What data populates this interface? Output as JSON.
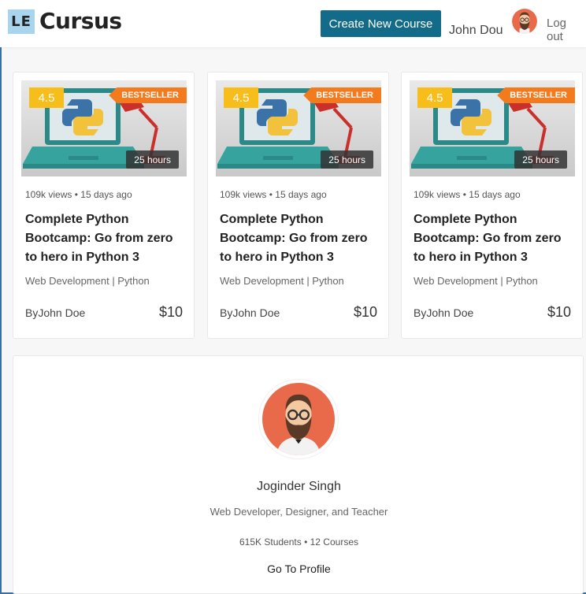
{
  "header": {
    "logo_mark": "LE",
    "brand": "Cursus",
    "create_button": "Create New Course",
    "user_name": "John Dou",
    "logout": "Log out"
  },
  "courses": [
    {
      "rating": "4.5",
      "badge": "BESTSELLER",
      "duration": "25 hours",
      "views": "109k views",
      "separator": "•",
      "age": "15 days ago",
      "title": "Complete Python Bootcamp: Go from zero to hero in Python 3",
      "category": "Web Development | Python",
      "by": "By",
      "author": "John Doe",
      "price": "$10"
    },
    {
      "rating": "4.5",
      "badge": "BESTSELLER",
      "duration": "25 hours",
      "views": "109k views",
      "separator": "•",
      "age": "15 days ago",
      "title": "Complete Python Bootcamp: Go from zero to hero in Python 3",
      "category": "Web Development | Python",
      "by": "By",
      "author": "John Doe",
      "price": "$10"
    },
    {
      "rating": "4.5",
      "badge": "BESTSELLER",
      "duration": "25 hours",
      "views": "109k views",
      "separator": "•",
      "age": "15 days ago",
      "title": "Complete Python Bootcamp: Go from zero to hero in Python 3",
      "category": "Web Development | Python",
      "by": "By",
      "author": "John Doe",
      "price": "$10"
    }
  ],
  "instructor": {
    "name": "Joginder Singh",
    "role": "Web Developer, Designer, and Teacher",
    "students": "615K Students",
    "separator": "•",
    "courses": "12 Courses",
    "profile_link": "Go To Profile"
  },
  "colors": {
    "primary_button": "#136b8a",
    "rating_badge": "#f6bd1b",
    "bestseller_badge": "#f47a1e",
    "logo_bg": "#a8d4ee"
  },
  "icons": {
    "thumbnail": "python-laptop-illustration",
    "avatar": "bearded-man-avatar"
  }
}
